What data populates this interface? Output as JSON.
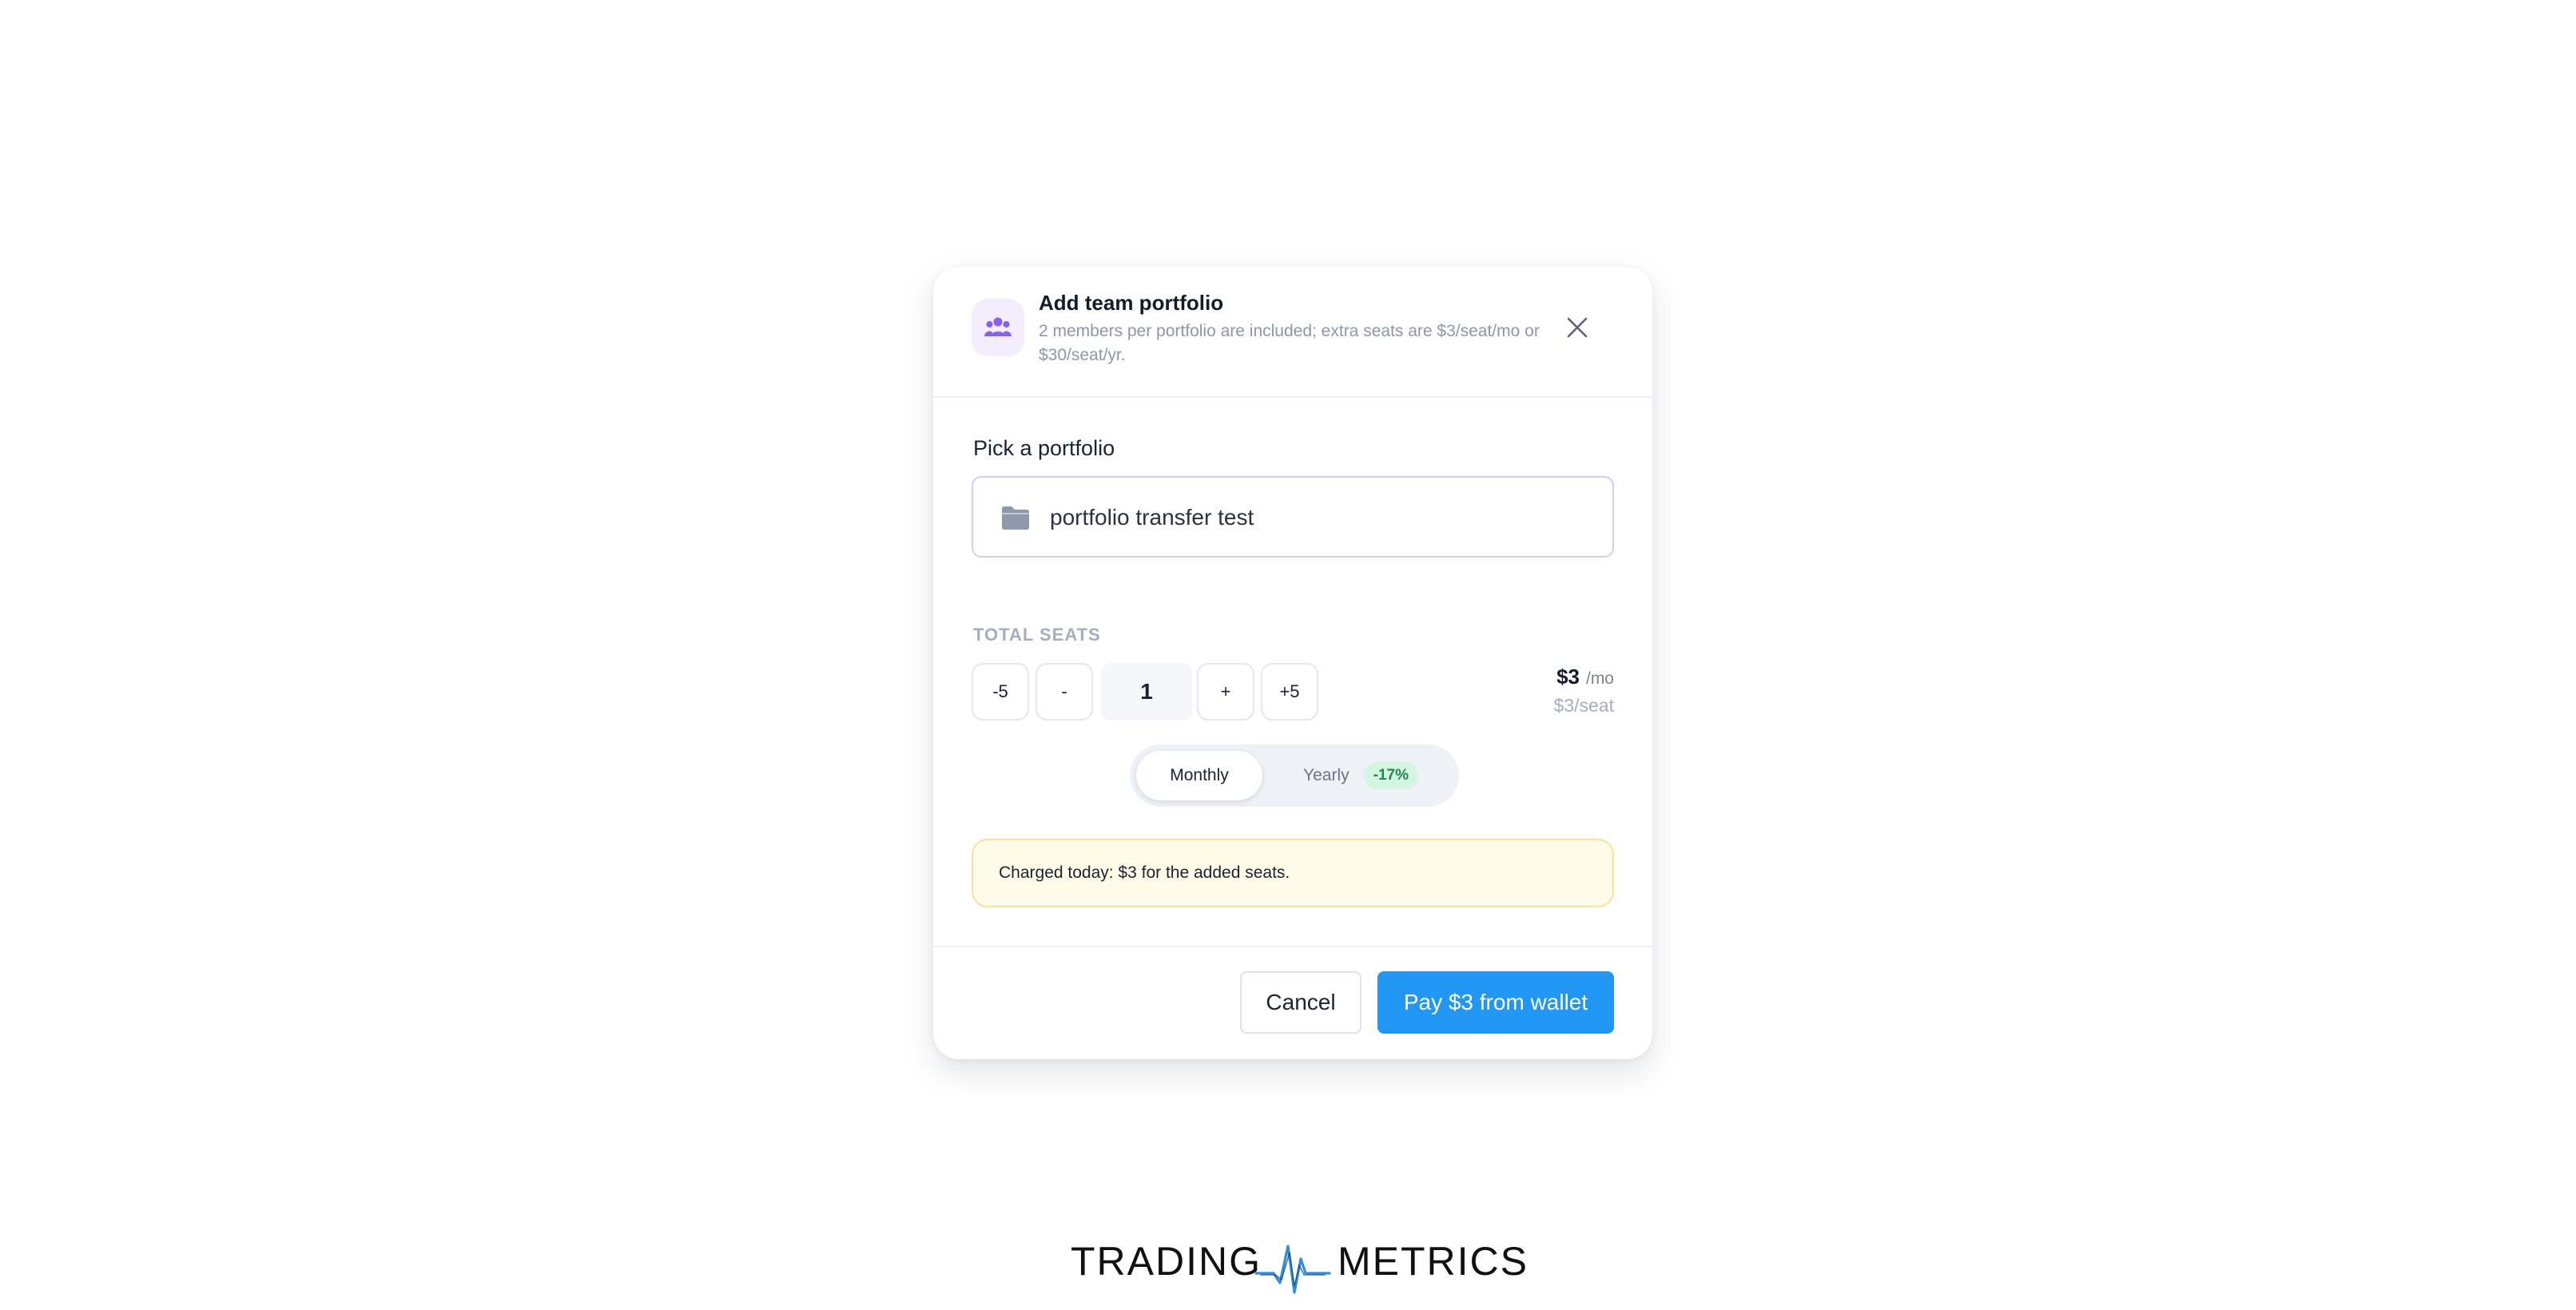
{
  "modal": {
    "title": "Add team portfolio",
    "subtitle": "2 members per portfolio are included; extra seats are $3/seat/mo or $30/seat/yr.",
    "header_icon": "users-icon",
    "close_icon": "close-icon"
  },
  "portfolio": {
    "label": "Pick a portfolio",
    "icon": "folder-icon",
    "selected": "portfolio transfer test"
  },
  "seats": {
    "label": "TOTAL SEATS",
    "buttons": {
      "minus5": "-5",
      "minus1": "-",
      "plus1": "+",
      "plus5": "+5"
    },
    "count": "1"
  },
  "price": {
    "amount": "$3",
    "period": "/mo",
    "per_seat": "$3/seat"
  },
  "billing": {
    "monthly": "Monthly",
    "yearly": "Yearly",
    "discount": "-17%",
    "selected": "Monthly"
  },
  "notice": {
    "text": "Charged today: $3 for the added seats."
  },
  "footer": {
    "cancel": "Cancel",
    "pay": "Pay $3 from wallet"
  },
  "brand": {
    "left": "TRADING",
    "right": "METRICS",
    "icon": "pulse-logo-icon"
  },
  "colors": {
    "accent": "#2196f3",
    "icon_purple": "#8b5cf6",
    "badge_green": "#1e8a4f",
    "notice_bg": "#fffbe8"
  }
}
